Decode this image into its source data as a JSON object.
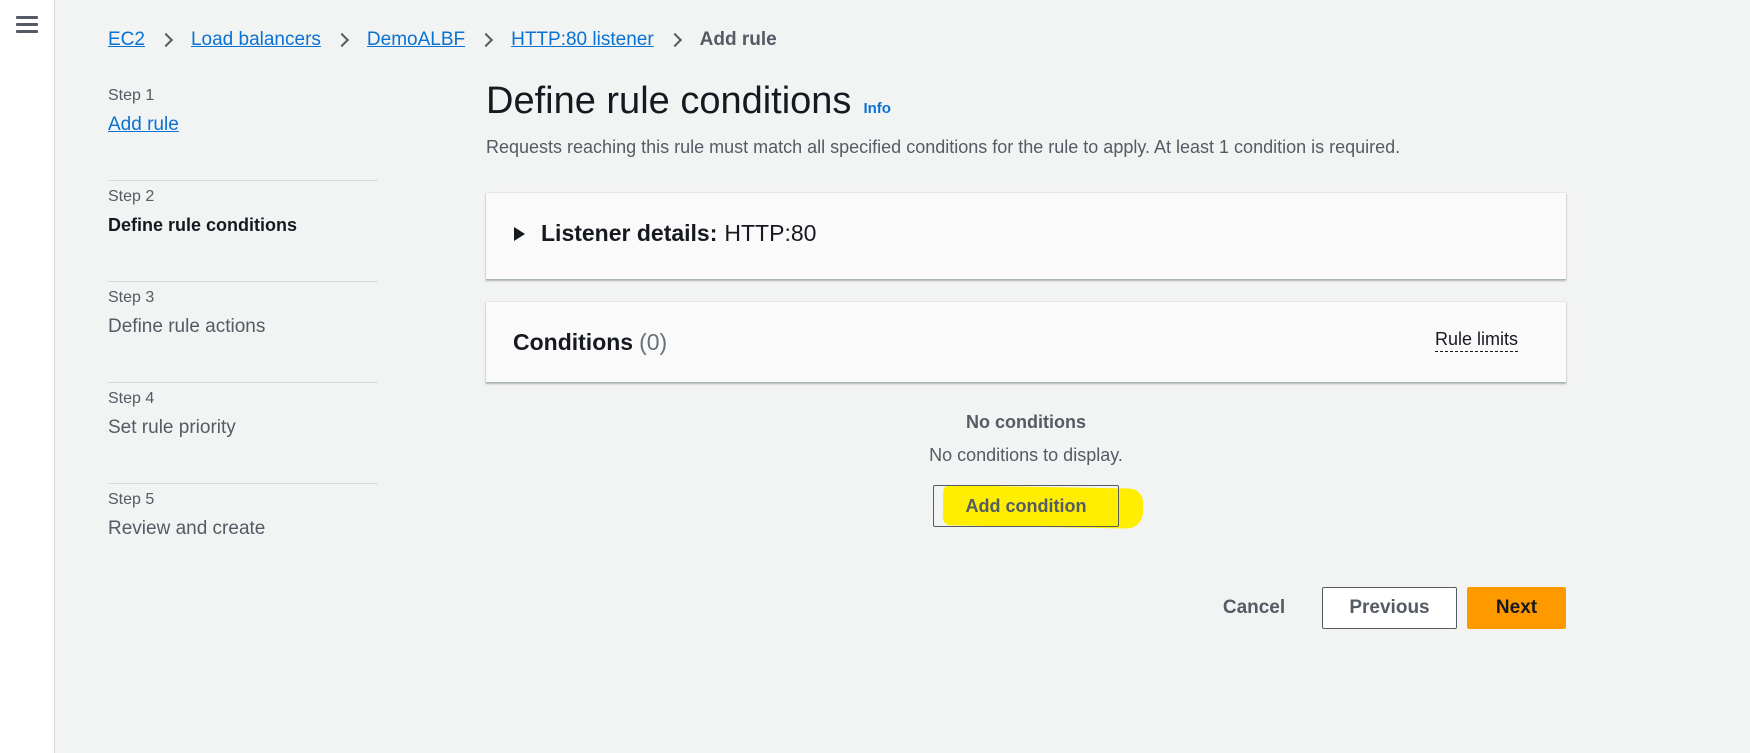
{
  "nav": {
    "menu_icon": "hamburger-menu-icon"
  },
  "breadcrumb": {
    "items": [
      "EC2",
      "Load balancers",
      "DemoALBF",
      "HTTP:80 listener"
    ],
    "current": "Add rule"
  },
  "steps": [
    {
      "number": "Step 1",
      "title": "Add rule",
      "state": "link"
    },
    {
      "number": "Step 2",
      "title": "Define rule conditions",
      "state": "active"
    },
    {
      "number": "Step 3",
      "title": "Define rule actions",
      "state": "inactive"
    },
    {
      "number": "Step 4",
      "title": "Set rule priority",
      "state": "inactive"
    },
    {
      "number": "Step 5",
      "title": "Review and create",
      "state": "inactive"
    }
  ],
  "main": {
    "title": "Define rule conditions",
    "info_label": "Info",
    "description": "Requests reaching this rule must match all specified conditions for the rule to apply. At least 1 condition is required."
  },
  "listener_panel": {
    "label": "Listener details:",
    "value": "HTTP:80",
    "expanded": false
  },
  "conditions_panel": {
    "title": "Conditions",
    "count": "(0)",
    "rule_limits_label": "Rule limits"
  },
  "empty_state": {
    "title": "No conditions",
    "description": "No conditions to display.",
    "add_button_label": "Add condition",
    "highlight_color": "#ffee00"
  },
  "actions": {
    "cancel_label": "Cancel",
    "previous_label": "Previous",
    "next_label": "Next",
    "primary_color": "#ff9900"
  }
}
